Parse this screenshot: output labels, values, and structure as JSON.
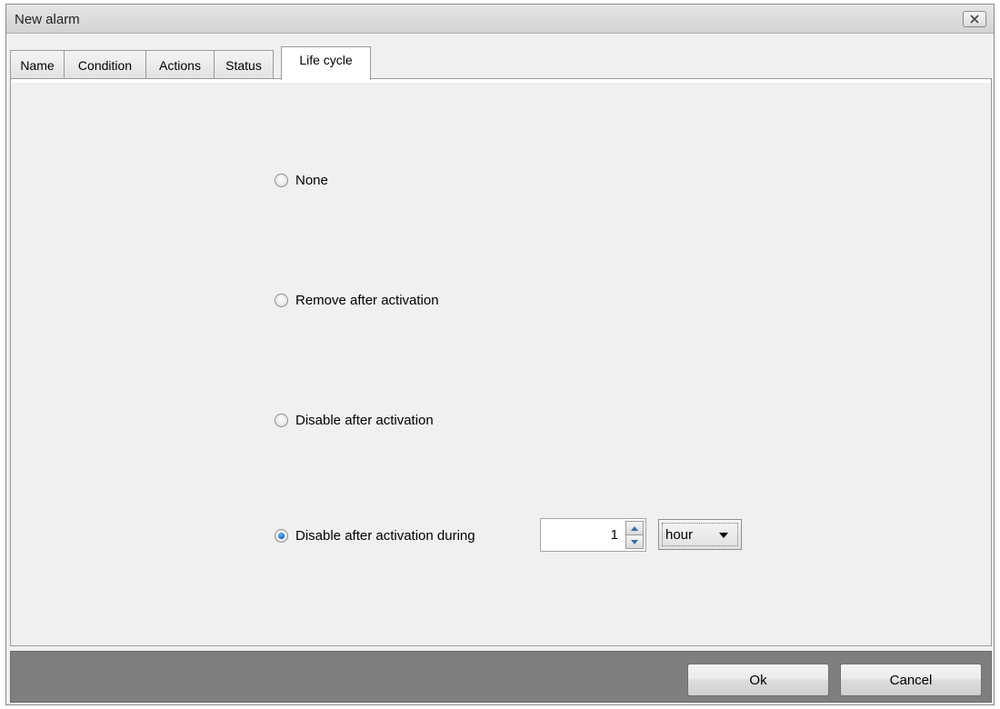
{
  "window": {
    "title": "New alarm"
  },
  "tabs": [
    {
      "label": "Name"
    },
    {
      "label": "Condition"
    },
    {
      "label": "Actions"
    },
    {
      "label": "Status"
    },
    {
      "label": "Life cycle",
      "active": true
    }
  ],
  "life_cycle": {
    "options": [
      {
        "label": "None",
        "checked": false
      },
      {
        "label": "Remove after activation",
        "checked": false
      },
      {
        "label": "Disable after activation",
        "checked": false
      },
      {
        "label": "Disable after activation during",
        "checked": true
      }
    ],
    "duration": {
      "value": "1"
    },
    "unit": {
      "selected": "hour"
    }
  },
  "footer": {
    "ok_label": "Ok",
    "cancel_label": "Cancel"
  },
  "icons": {
    "close": "close-icon",
    "spin_up": "chevron-up-icon",
    "spin_down": "chevron-down-icon",
    "dropdown": "dropdown-arrow-icon"
  }
}
